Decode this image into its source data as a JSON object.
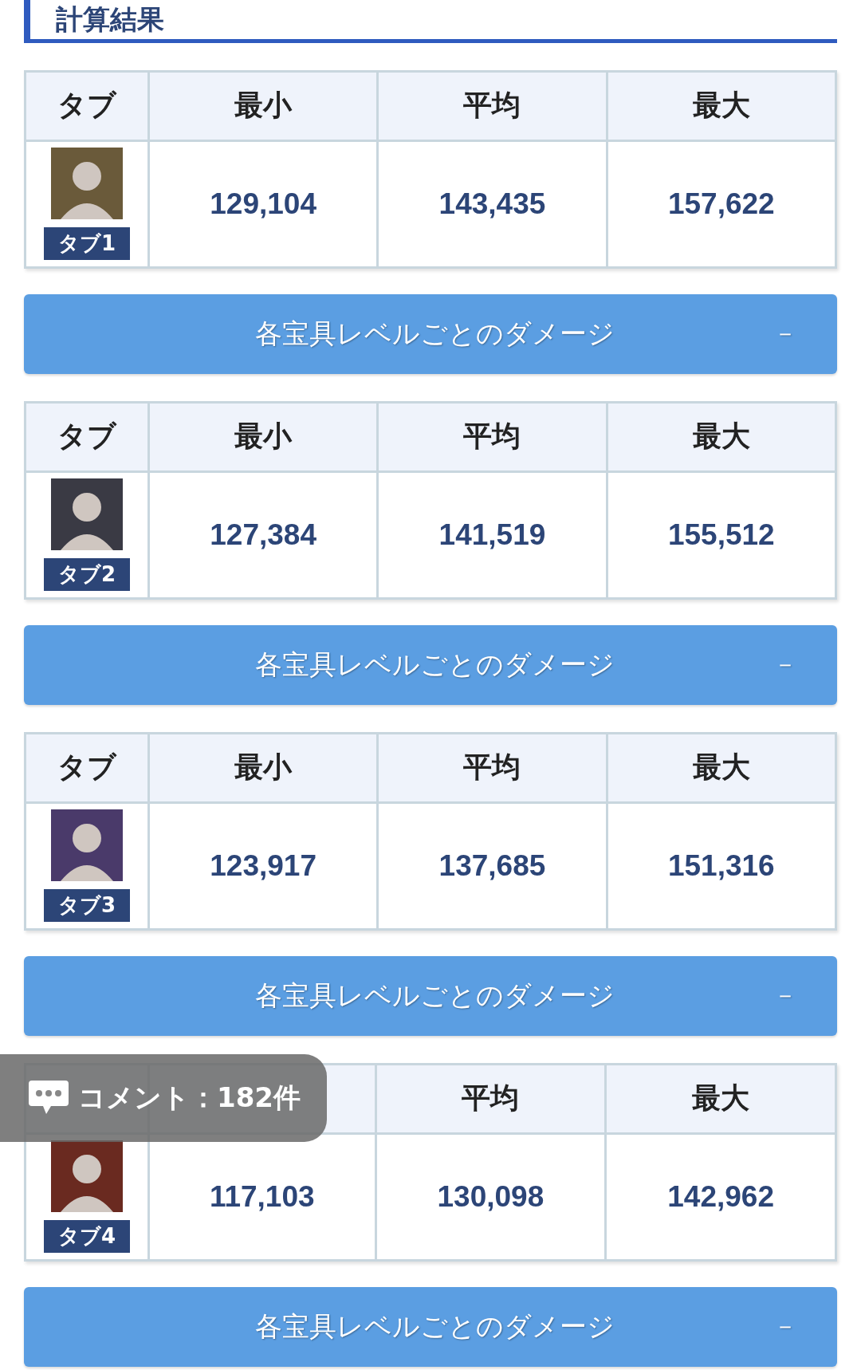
{
  "title": "計算結果",
  "results": [
    {
      "columns": [
        "タブ",
        "最小",
        "平均",
        "最大"
      ],
      "tab": "タブ1",
      "min": "129,104",
      "avg": "143,435",
      "max": "157,622",
      "toggle": {
        "label": "各宝具レベルごとのダメージ",
        "icon": "－"
      }
    },
    {
      "columns": [
        "タブ",
        "最小",
        "平均",
        "最大"
      ],
      "tab": "タブ2",
      "min": "127,384",
      "avg": "141,519",
      "max": "155,512",
      "toggle": {
        "label": "各宝具レベルごとのダメージ",
        "icon": "－"
      }
    },
    {
      "columns": [
        "タブ",
        "最小",
        "平均",
        "最大"
      ],
      "tab": "タブ3",
      "min": "123,917",
      "avg": "137,685",
      "max": "151,316",
      "toggle": {
        "label": "各宝具レベルごとのダメージ",
        "icon": "－"
      }
    },
    {
      "columns": [
        "平均",
        "最大"
      ],
      "tab": "タブ4",
      "min": "117,103",
      "avg": "130,098",
      "max": "142,962",
      "toggle": {
        "label": "各宝具レベルごとのダメージ",
        "icon": "－"
      }
    }
  ],
  "comments": {
    "label": "コメント：182件"
  }
}
